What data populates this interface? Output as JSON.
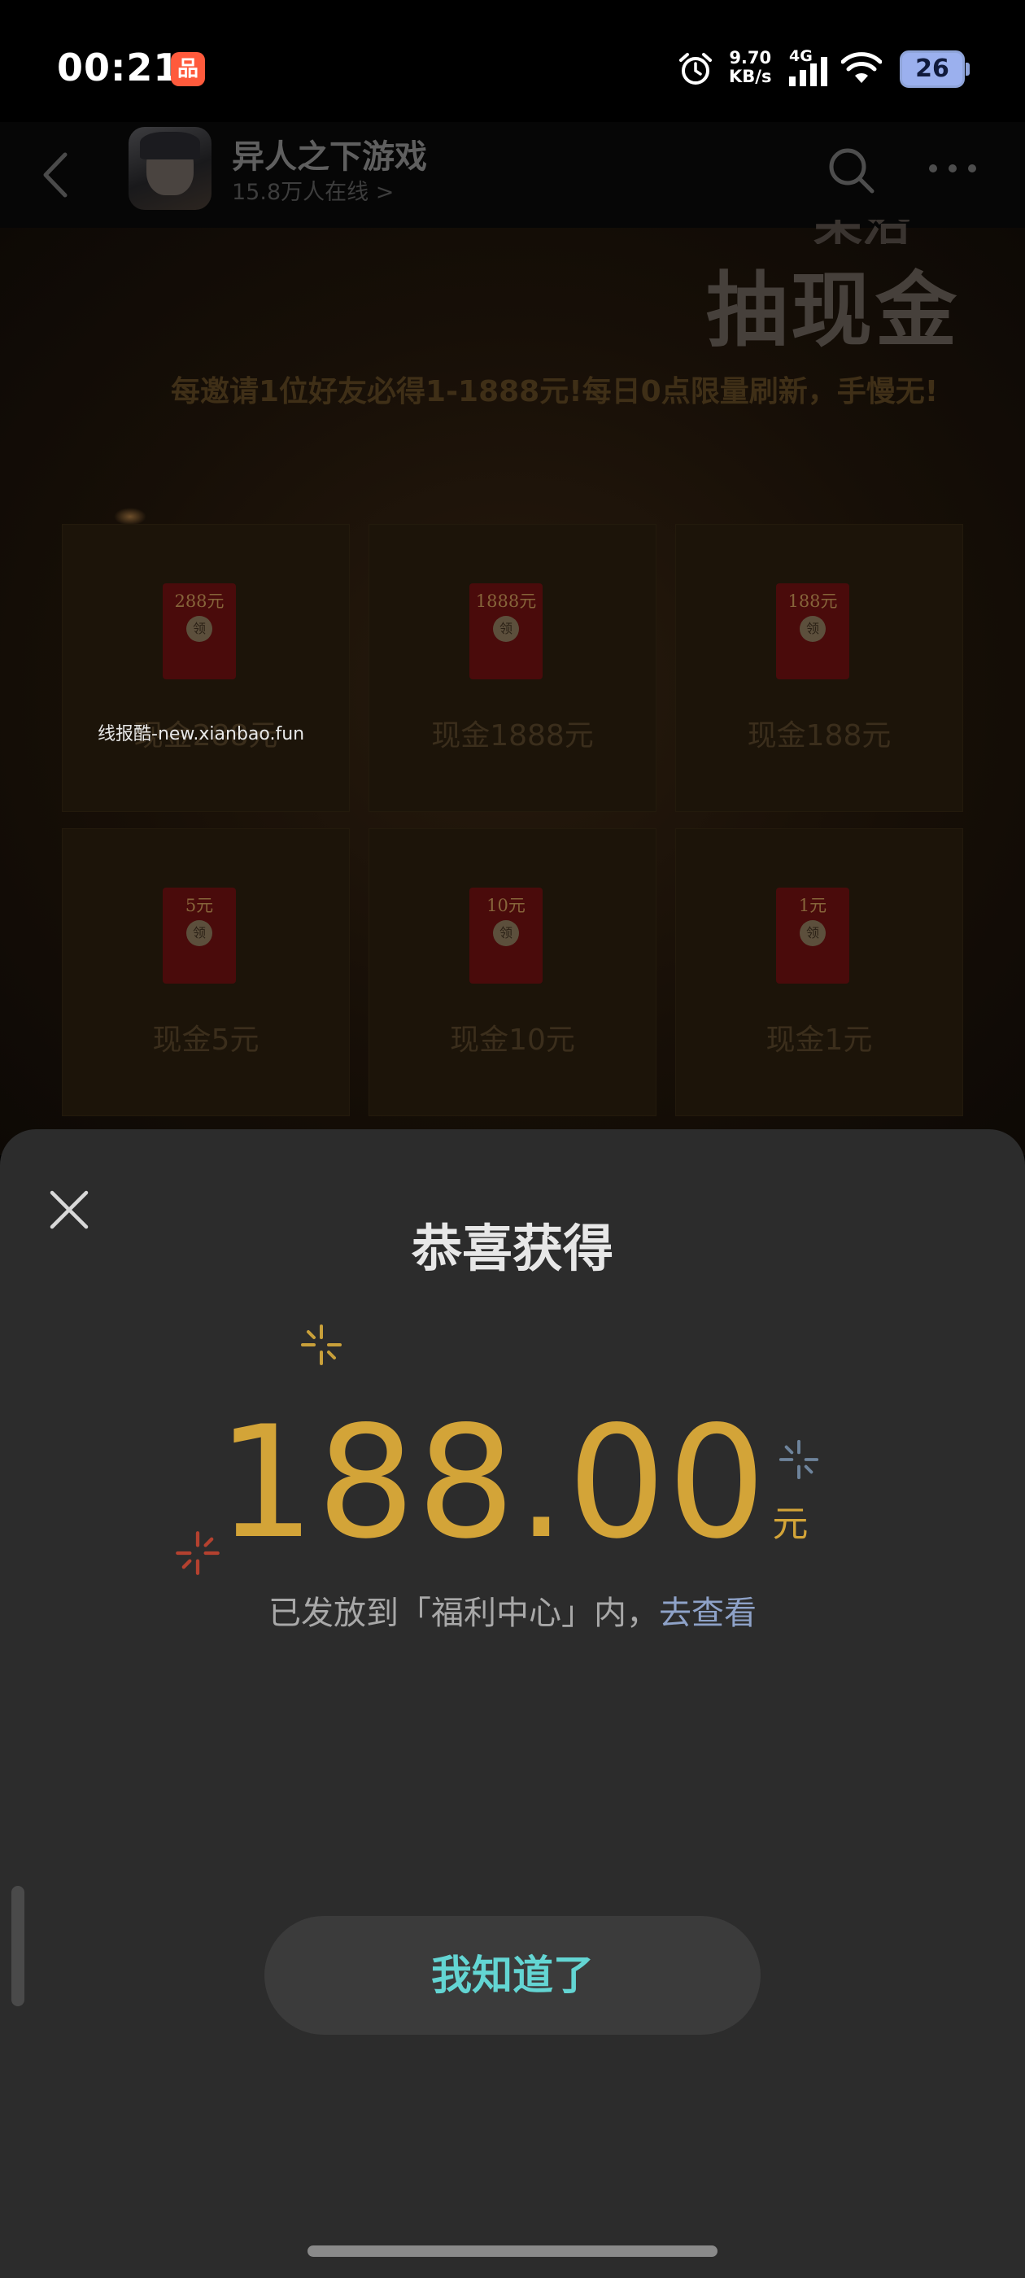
{
  "status_bar": {
    "time": "00:21",
    "app_badge": "品",
    "net_speed_value": "9.70",
    "net_speed_unit": "KB/s",
    "network_type": "4G",
    "battery_level": "26"
  },
  "header": {
    "title": "异人之下游戏",
    "subtitle": "15.8万人在线 >"
  },
  "promo": {
    "title_top": "呆沿",
    "title": "抽现金",
    "subline": "每邀请1位好友必得1-1888元!每日0点限量刷新，手慢无!",
    "watermark": "线报酷-new.xianbao.fun",
    "seal_text": "领",
    "cells": [
      {
        "amount": "288元",
        "label": "现金288元"
      },
      {
        "amount": "1888元",
        "label": "现金1888元"
      },
      {
        "amount": "188元",
        "label": "现金188元"
      },
      {
        "amount": "5元",
        "label": "现金5元"
      },
      {
        "amount": "10元",
        "label": "现金10元"
      },
      {
        "amount": "1元",
        "label": "现金1元"
      }
    ]
  },
  "dialog": {
    "title": "恭喜获得",
    "amount": "188.00",
    "unit": "元",
    "notice": "已发放到「福利中心」内，",
    "notice_link": "去查看",
    "confirm_label": "我知道了"
  },
  "colors": {
    "gold": "#d3a438",
    "button_text": "#63d5d3",
    "link": "#8ea2c8",
    "sheet_bg": "#2c2c2c"
  },
  "icons": [
    "alarm-icon",
    "signal-icon",
    "wifi-icon",
    "back-icon",
    "search-icon",
    "more-icon",
    "close-icon",
    "sparkle-icon"
  ]
}
